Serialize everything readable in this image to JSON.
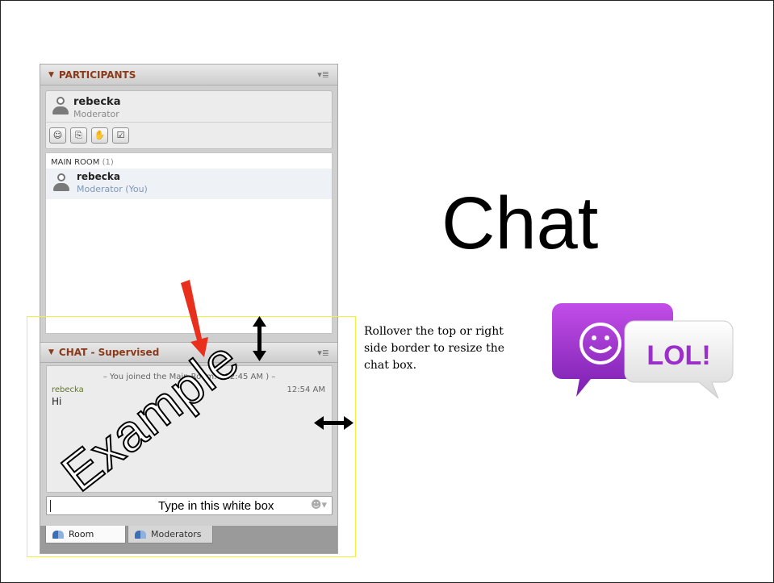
{
  "participants": {
    "header": "PARTICIPANTS",
    "current_user": {
      "name": "rebecka",
      "role": "Moderator"
    },
    "room": {
      "label": "MAIN ROOM",
      "count": "(1)"
    },
    "list": [
      {
        "name": "rebecka",
        "role": "Moderator (You)"
      }
    ]
  },
  "chat": {
    "header": "CHAT - Supervised",
    "system_message": "– You joined the Main Room. ( 12:45 AM ) –",
    "messages": [
      {
        "sender": "rebecka",
        "time": "12:54 AM",
        "text": "Hi"
      }
    ],
    "input_hint": "Type in this white box",
    "tabs": [
      {
        "label": "Room",
        "active": true
      },
      {
        "label": "Moderators",
        "active": false
      }
    ]
  },
  "slide": {
    "title": "Chat",
    "caption": "Rollover the top or right side border to resize the chat box.",
    "watermark": "Example",
    "logo_text": "LOL!"
  },
  "colors": {
    "highlight_box": "#f2f03a",
    "arrow": "#e8301c",
    "logo_purple": "#9b2fc9"
  }
}
